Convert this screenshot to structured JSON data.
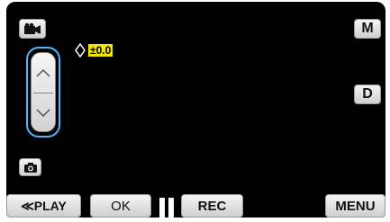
{
  "top": {
    "mode_icon": "movie-camera-icon",
    "manual_label": "M"
  },
  "exposure": {
    "icon": "diamond-icon",
    "value": "±0.0"
  },
  "adjust": {
    "up_icon": "chevron-up-icon",
    "down_icon": "chevron-down-icon"
  },
  "right": {
    "display_label": "D"
  },
  "left": {
    "still_icon": "camera-icon"
  },
  "bottom": {
    "play_label": "≪PLAY",
    "ok_label": "OK",
    "pause_icon": "pause-icon",
    "rec_label": "REC",
    "menu_label": "MENU"
  },
  "colors": {
    "screen": "#000000",
    "highlight": "#4fb7ff",
    "value_bg": "#f0e600"
  }
}
